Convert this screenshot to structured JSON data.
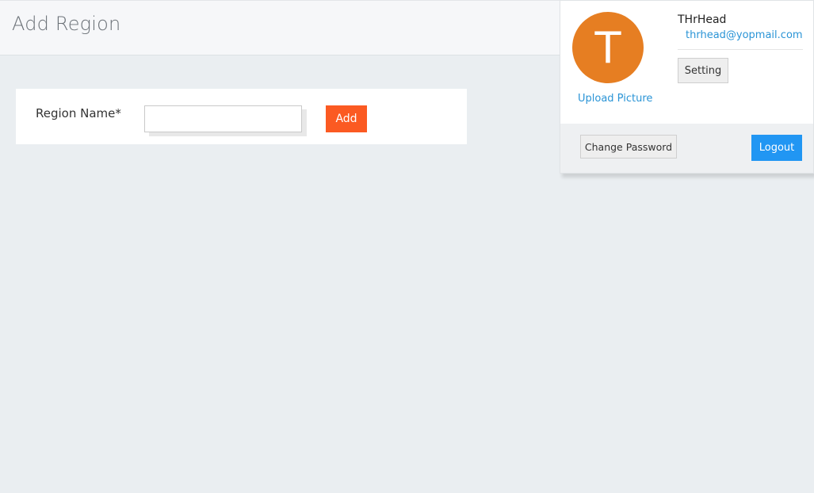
{
  "page": {
    "title": "Add Region"
  },
  "form": {
    "region_label": "Region Name*",
    "region_value": "",
    "region_placeholder": "",
    "add_label": "Add"
  },
  "profile": {
    "avatar_initial": "T",
    "upload_label": "Upload Picture",
    "name": "THrHead",
    "email": "thrhead@yopmail.com",
    "setting_label": "Setting",
    "change_password_label": "Change Password",
    "logout_label": "Logout"
  },
  "colors": {
    "avatar": "#e67e22",
    "add_button": "#fb5a22",
    "logout_button": "#2196f3",
    "link": "#2a94d6"
  }
}
